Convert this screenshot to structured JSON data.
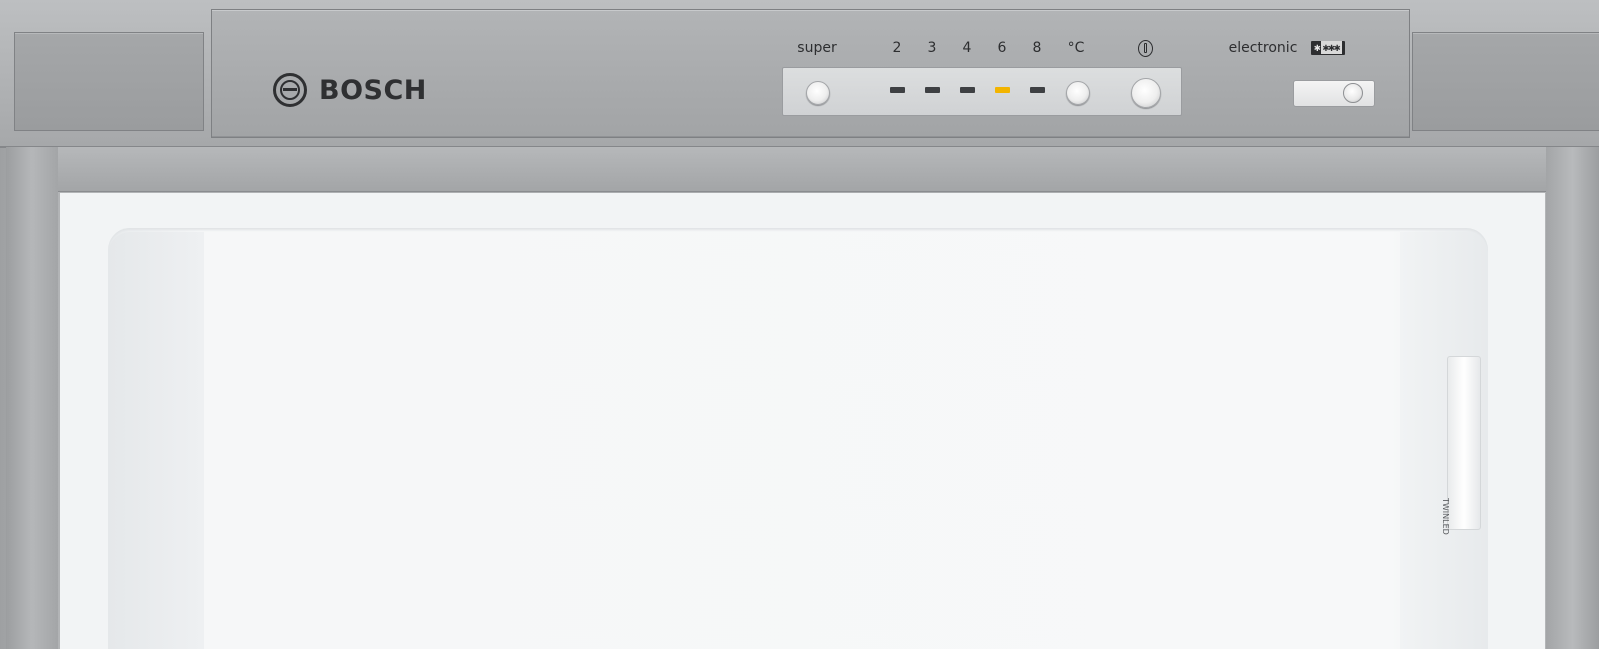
{
  "brand": {
    "logo_text": "BOSCH"
  },
  "control_panel": {
    "super_label": "super",
    "temperature_levels": [
      "2",
      "3",
      "4",
      "6",
      "8"
    ],
    "unit_label": "°C",
    "active_level": "6",
    "electronic_label": "electronic",
    "freezer_rating_star": "✱",
    "freezer_rating_stars": "✱✱✱"
  },
  "interior": {
    "light_label": "TWINLED"
  },
  "colors": {
    "stainless": "#a9abad",
    "display_strip": "#d4d6d8",
    "led_off": "#3e4043",
    "led_active": "#f2b400",
    "interior": "#f4f6f7"
  }
}
